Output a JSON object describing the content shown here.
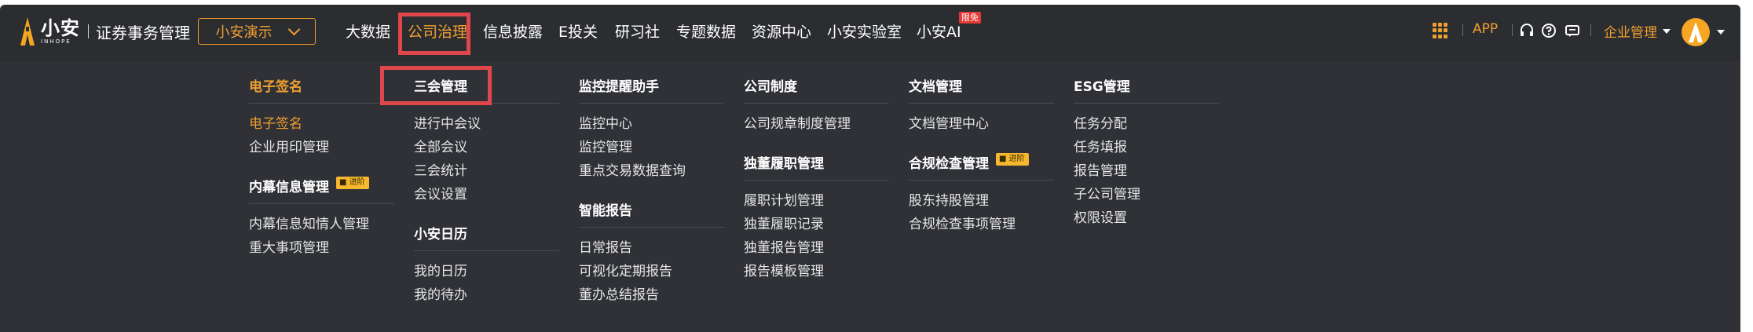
{
  "header": {
    "logo_cn": "小安",
    "logo_en": "INHOPE",
    "product": "证券事务管理",
    "org_select": "小安演示",
    "nav": [
      {
        "label": "大数据",
        "active": false
      },
      {
        "label": "公司治理",
        "active": true
      },
      {
        "label": "信息披露",
        "active": false
      },
      {
        "label": "E投关",
        "active": false
      },
      {
        "label": "研习社",
        "active": false
      },
      {
        "label": "专题数据",
        "active": false
      },
      {
        "label": "资源中心",
        "active": false
      },
      {
        "label": "小安实验室",
        "active": false
      },
      {
        "label": "小安AI",
        "active": false
      }
    ],
    "new_badge": "限免",
    "app_label": "APP",
    "enterprise_menu": "企业管理"
  },
  "menu": {
    "col1": {
      "sec1_title": "电子签名",
      "sec1_items": [
        "电子签名",
        "企业用印管理"
      ],
      "sec2_title": "内幕信息管理",
      "sec2_badge": "进阶",
      "sec2_items": [
        "内幕信息知情人管理",
        "重大事项管理"
      ]
    },
    "col2": {
      "sec1_title": "三会管理",
      "sec1_items": [
        "进行中会议",
        "全部会议",
        "三会统计",
        "会议设置"
      ],
      "sec2_title": "小安日历",
      "sec2_items": [
        "我的日历",
        "我的待办"
      ]
    },
    "col3": {
      "sec1_title": "监控提醒助手",
      "sec1_items": [
        "监控中心",
        "监控管理",
        "重点交易数据查询"
      ],
      "sec2_title": "智能报告",
      "sec2_items": [
        "日常报告",
        "可视化定期报告",
        "董办总结报告"
      ]
    },
    "col4": {
      "sec1_title": "公司制度",
      "sec1_items": [
        "公司规章制度管理"
      ],
      "sec2_title": "独董履职管理",
      "sec2_items": [
        "履职计划管理",
        "独董履职记录",
        "独董报告管理",
        "报告模板管理"
      ]
    },
    "col5": {
      "sec1_title": "文档管理",
      "sec1_items": [
        "文档管理中心"
      ],
      "sec2_title": "合规检查管理",
      "sec2_badge": "进阶",
      "sec2_items": [
        "股东持股管理",
        "合规检查事项管理"
      ]
    },
    "col6": {
      "sec1_title": "ESG管理",
      "sec1_items": [
        "任务分配",
        "任务填报",
        "报告管理",
        "子公司管理",
        "权限设置"
      ]
    }
  },
  "colors": {
    "accent": "#f0a030",
    "topbar_bg": "#2b2d31",
    "panel_bg": "#2f3136",
    "highlight_red": "#e0474c",
    "badge_yellow": "#f5b82e"
  }
}
